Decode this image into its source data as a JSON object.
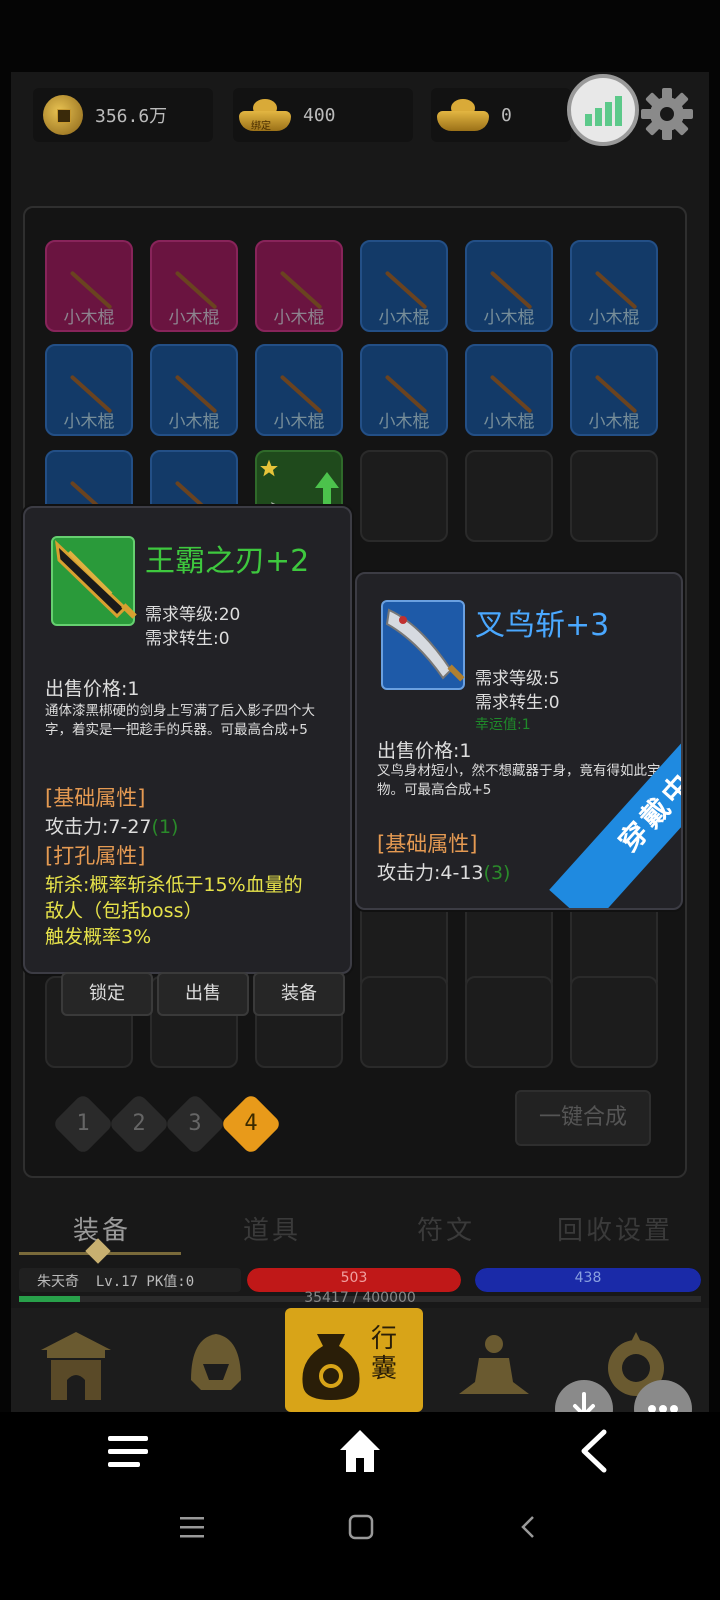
{
  "currencies": {
    "gold": "356.6万",
    "bound_ingot_label": "绑定",
    "bound_ingot": "400",
    "ingot": "0"
  },
  "bag_slots": [
    {
      "color": "purple",
      "name": "小木棍"
    },
    {
      "color": "purple",
      "name": "小木棍"
    },
    {
      "color": "purple",
      "name": "小木棍"
    },
    {
      "color": "blue",
      "name": "小木棍"
    },
    {
      "color": "blue",
      "name": "小木棍"
    },
    {
      "color": "blue",
      "name": "小木棍"
    },
    {
      "color": "blue",
      "name": "小木棍"
    },
    {
      "color": "blue",
      "name": "小木棍"
    },
    {
      "color": "blue",
      "name": "小木棍"
    },
    {
      "color": "blue",
      "name": "小木棍"
    },
    {
      "color": "blue",
      "name": "小木棍"
    },
    {
      "color": "blue",
      "name": "小木棍"
    }
  ],
  "tooltip_left": {
    "title": "王霸之刃+2",
    "req_level": "需求等级:20",
    "req_rebirth": "需求转生:0",
    "price": "出售价格:1",
    "desc": "通体漆黑梆硬的剑身上写满了后入影子四个大字，着实是一把趁手的兵器。可最高合成+5",
    "base_header": "[基础属性]",
    "attack": "攻击力:7-27",
    "attack_bonus": "(1)",
    "socket_header": "[打孔属性]",
    "socket_text1": "斩杀:概率斩杀低于15%血量的",
    "socket_text2": "敌人（包括boss）",
    "socket_text3": "触发概率3%"
  },
  "tooltip_right": {
    "title": "叉鸟斩+3",
    "req_level": "需求等级:5",
    "req_rebirth": "需求转生:0",
    "luck": "幸运值:1",
    "price": "出售价格:1",
    "desc": "叉鸟身材短小，然不想藏器于身，竟有得如此宝物。可最高合成+5",
    "base_header": "[基础属性]",
    "attack": "攻击力:4-13",
    "attack_bonus": "(3)",
    "equipped_badge": "穿戴中"
  },
  "actions": {
    "lock": "锁定",
    "sell": "出售",
    "equip": "装备"
  },
  "pages": [
    "1",
    "2",
    "3",
    "4"
  ],
  "current_page": "4",
  "merge_all": "一键合成",
  "tabs": [
    "装备",
    "道具",
    "符文",
    "回收设置"
  ],
  "player": {
    "info": "朱天奇  Lv.17 PK值:0",
    "hp": "503",
    "mp": "438",
    "exp": "35417 / 400000",
    "hp_fill": 1.0,
    "mp_fill": 1.0,
    "exp_fill": 0.09
  },
  "bottom_nav": {
    "bag_label": "行囊"
  }
}
